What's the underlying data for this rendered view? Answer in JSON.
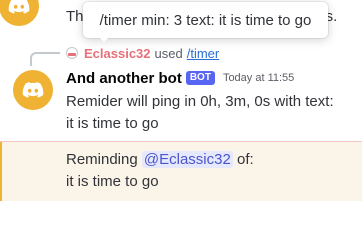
{
  "top_message": {
    "text_start": "Th",
    "text_end": "bers."
  },
  "tooltip": {
    "text": "/timer min: 3 text: it is time to go"
  },
  "reply": {
    "username": "Eclassic32",
    "used_text": "used",
    "command": "/timer"
  },
  "bot_message": {
    "author": "And another bot",
    "tag": "BOT",
    "timestamp": "Today at 11:55",
    "line1": "Remider will ping in 0h, 3m, 0s with text:",
    "line2": "it is time to go"
  },
  "mention_message": {
    "prefix": "Reminding",
    "mention": "@Eclassic32",
    "suffix": "of:",
    "line2": "it is time to go"
  },
  "colors": {
    "avatar_bg": "#f0b232",
    "mention_highlight": "#fbf4e9",
    "bot_tag": "#5865f2",
    "reply_username": "#e8707a",
    "link": "#2a6fd6"
  },
  "icons": {
    "avatar": "discord-logo-icon"
  }
}
